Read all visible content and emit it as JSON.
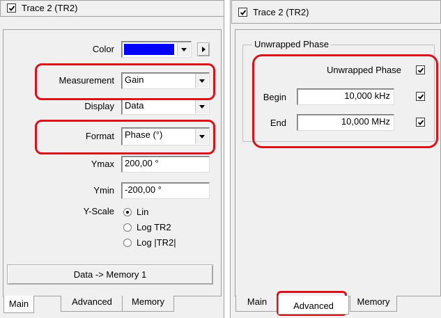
{
  "left": {
    "title": "Trace 2 (TR2)",
    "color": {
      "label": "Color",
      "swatch": "#0000ff"
    },
    "measurement": {
      "label": "Measurement",
      "value": "Gain"
    },
    "display": {
      "label": "Display",
      "value": "Data"
    },
    "format": {
      "label": "Format",
      "value": "Phase (°)"
    },
    "ymax": {
      "label": "Ymax",
      "value": "200,00 °"
    },
    "ymin": {
      "label": "Ymin",
      "value": "-200,00 °"
    },
    "yscale": {
      "label": "Y-Scale",
      "options": [
        "Lin",
        "Log TR2",
        "Log |TR2|"
      ]
    },
    "data_memory_button": "Data -> Memory 1",
    "tabs": [
      "Main",
      "Advanced",
      "Memory"
    ]
  },
  "right": {
    "title": "Trace 2 (TR2)",
    "group_title": "Unwrapped Phase",
    "unwrapped_label": "Unwrapped Phase",
    "begin": {
      "label": "Begin",
      "value": "10,000 kHz"
    },
    "end": {
      "label": "End",
      "value": "10,000 MHz"
    },
    "tabs": [
      "Main",
      "Advanced",
      "Memory"
    ]
  },
  "highlight_color": "#d6141a"
}
